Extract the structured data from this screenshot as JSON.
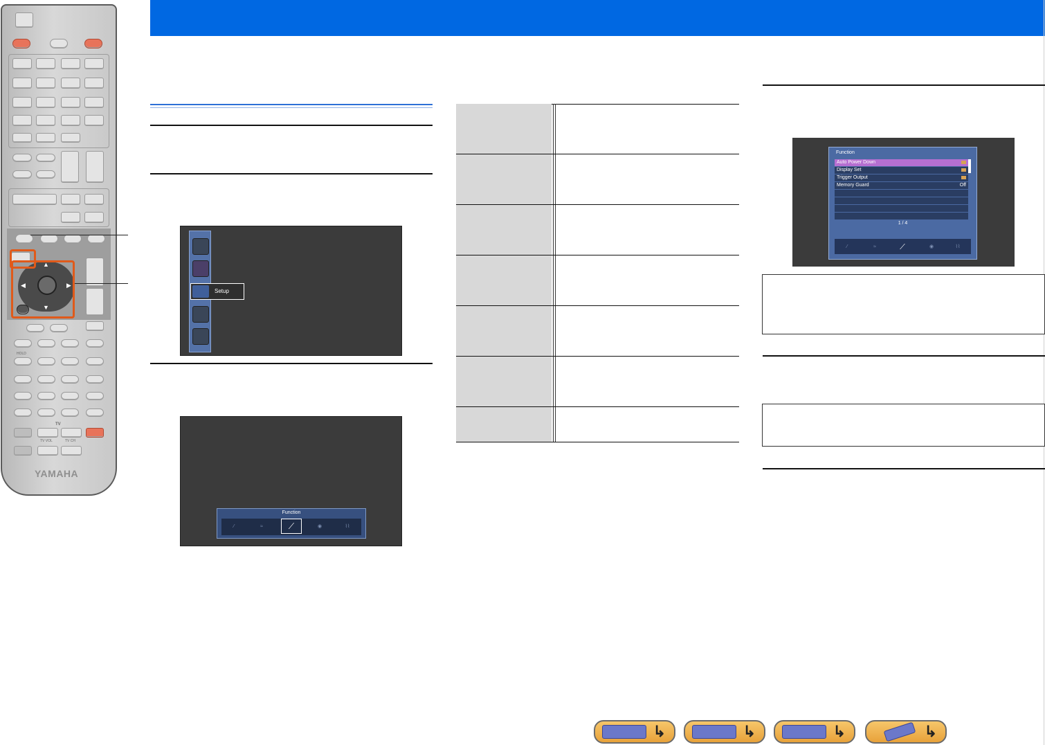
{
  "remote": {
    "brand_logo": "YAMAHA",
    "labels": {
      "hold": "HOLD",
      "tv": "TV",
      "tv_vol": "TV VOL",
      "tv_ch": "TV CH"
    }
  },
  "screen1": {
    "setup_label": "Setup"
  },
  "screen2": {
    "function_label": "Function"
  },
  "osd": {
    "title": "Function",
    "items": [
      {
        "label": "Auto Power Down",
        "value": ""
      },
      {
        "label": "Display Set",
        "value": ""
      },
      {
        "label": "Trigger Output",
        "value": ""
      },
      {
        "label": "Memory Guard",
        "value": "Off"
      }
    ],
    "page": "1 / 4"
  },
  "colors": {
    "header": "#0068e2",
    "highlight": "#e05a1a",
    "nav": "#e8a23a"
  },
  "nav": [
    {
      "name": "front-panel-nav",
      "icon": "receiver-front-icon"
    },
    {
      "name": "rear-panel-nav",
      "icon": "receiver-rear-icon"
    },
    {
      "name": "display-panel-nav",
      "icon": "front-display-icon"
    },
    {
      "name": "remote-nav",
      "icon": "remote-control-icon"
    }
  ]
}
